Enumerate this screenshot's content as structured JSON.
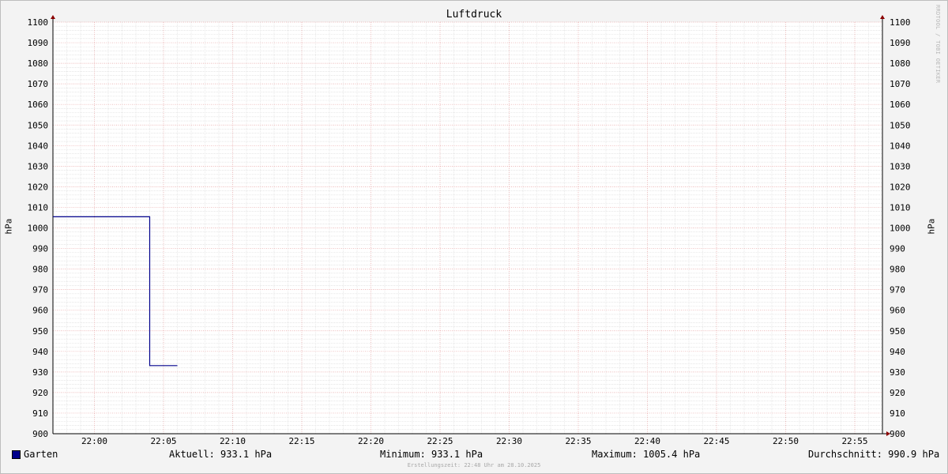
{
  "chart_data": {
    "type": "line",
    "title": "Luftdruck",
    "ylabel": "hPa",
    "ylim": [
      900,
      1100
    ],
    "yticks": [
      900,
      910,
      920,
      930,
      940,
      950,
      960,
      970,
      980,
      990,
      1000,
      1010,
      1020,
      1030,
      1040,
      1050,
      1060,
      1070,
      1080,
      1090,
      1100
    ],
    "xrange": [
      "21:57",
      "22:57"
    ],
    "xticks": [
      "22:00",
      "22:05",
      "22:10",
      "22:15",
      "22:20",
      "22:25",
      "22:30",
      "22:35",
      "22:40",
      "22:45",
      "22:50",
      "22:55"
    ],
    "grid": true,
    "step": true,
    "series": [
      {
        "name": "Garten",
        "color": "#00008b",
        "points": [
          {
            "x": "21:57",
            "y": 1005.4
          },
          {
            "x": "22:04",
            "y": 1005.4
          },
          {
            "x": "22:04",
            "y": 933.1
          },
          {
            "x": "22:06",
            "y": 933.1
          }
        ]
      }
    ]
  },
  "legend": {
    "series_name": "Garten",
    "swatch_color": "#00008b",
    "current": "Aktuell: 933.1 hPa",
    "minimum": "Minimum: 933.1 hPa",
    "maximum": "Maximum: 1005.4 hPa",
    "average": "Durchschnitt: 990.9 hPa"
  },
  "watermark": "RRDTOOL / TOBI OETIKER",
  "footer": "Erstellungszeit: 22:48 Uhr am 28.10.2025"
}
